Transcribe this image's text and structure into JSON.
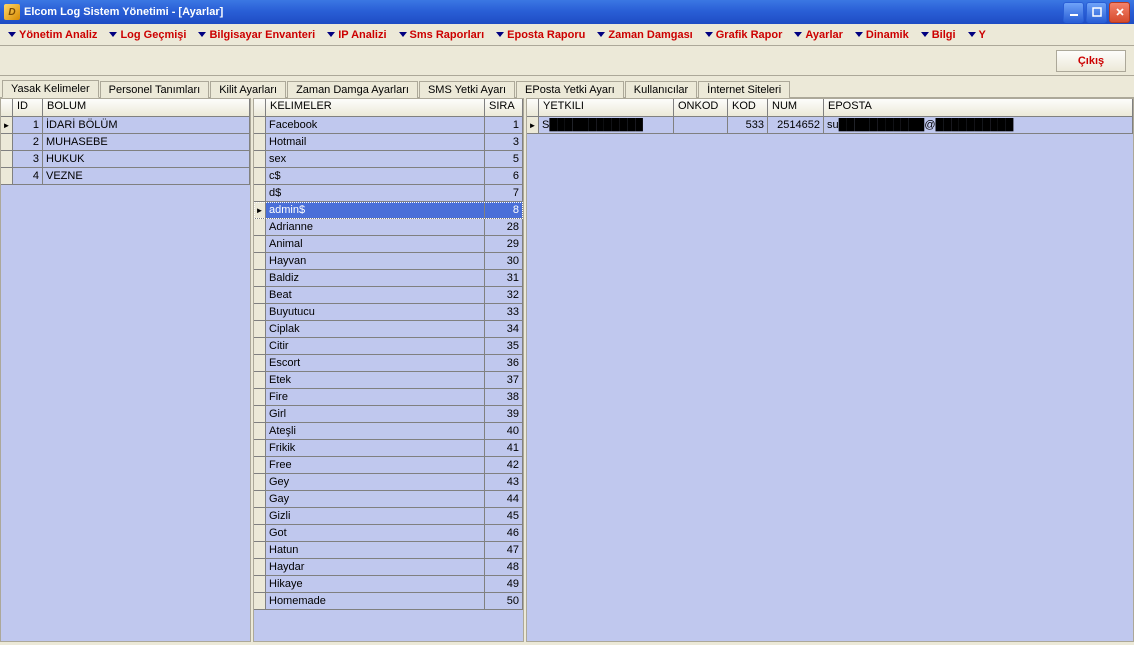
{
  "window": {
    "title": "Elcom Log Sistem Yönetimi - [Ayarlar]"
  },
  "menu": [
    "Yönetim Analiz",
    "Log Geçmişi",
    "Bilgisayar Envanteri",
    "IP Analizi",
    "Sms Raporları",
    "Eposta Raporu",
    "Zaman Damgası",
    "Grafik Rapor",
    "Ayarlar",
    "Dinamik",
    "Bilgi",
    "Y"
  ],
  "toolbar": {
    "logout": "Çıkış"
  },
  "tabs": [
    "Yasak Kelimeler",
    "Personel Tanımları",
    "Kilit Ayarları",
    "Zaman Damga Ayarları",
    "SMS Yetki Ayarı",
    "EPosta Yetki Ayarı",
    "Kullanıcılar",
    "İnternet Siteleri"
  ],
  "activeTab": 0,
  "pane1": {
    "headers": [
      "ID",
      "BOLUM"
    ],
    "rows": [
      {
        "id": "1",
        "bolum": "İDARİ BÖLÜM"
      },
      {
        "id": "2",
        "bolum": "MUHASEBE"
      },
      {
        "id": "3",
        "bolum": "HUKUK"
      },
      {
        "id": "4",
        "bolum": "VEZNE"
      }
    ],
    "current": 0
  },
  "pane2": {
    "headers": [
      "KELIMELER",
      "SIRA"
    ],
    "rows": [
      {
        "k": "Facebook",
        "s": "1"
      },
      {
        "k": "Hotmail",
        "s": "3"
      },
      {
        "k": "sex",
        "s": "5"
      },
      {
        "k": "c$",
        "s": "6"
      },
      {
        "k": "d$",
        "s": "7"
      },
      {
        "k": "admin$",
        "s": "8"
      },
      {
        "k": "Adrianne",
        "s": "28"
      },
      {
        "k": "Animal",
        "s": "29"
      },
      {
        "k": "Hayvan",
        "s": "30"
      },
      {
        "k": "Baldiz",
        "s": "31"
      },
      {
        "k": "Beat",
        "s": "32"
      },
      {
        "k": "Buyutucu",
        "s": "33"
      },
      {
        "k": "Ciplak",
        "s": "34"
      },
      {
        "k": "Citir",
        "s": "35"
      },
      {
        "k": "Escort",
        "s": "36"
      },
      {
        "k": "Etek",
        "s": "37"
      },
      {
        "k": "Fire",
        "s": "38"
      },
      {
        "k": "Girl",
        "s": "39"
      },
      {
        "k": "Ateşli",
        "s": "40"
      },
      {
        "k": "Frikik",
        "s": "41"
      },
      {
        "k": "Free",
        "s": "42"
      },
      {
        "k": "Gey",
        "s": "43"
      },
      {
        "k": "Gay",
        "s": "44"
      },
      {
        "k": "Gizli",
        "s": "45"
      },
      {
        "k": "Got",
        "s": "46"
      },
      {
        "k": "Hatun",
        "s": "47"
      },
      {
        "k": "Haydar",
        "s": "48"
      },
      {
        "k": "Hikaye",
        "s": "49"
      },
      {
        "k": "Homemade",
        "s": "50"
      }
    ],
    "selected": 5,
    "current": 5
  },
  "pane3": {
    "headers": [
      "YETKILI",
      "ONKOD",
      "KOD",
      "NUM",
      "EPOSTA"
    ],
    "rows": [
      {
        "yet": "S████████████",
        "onk": "",
        "kod": "533",
        "num": "2514652",
        "epo": "su███████████@██████████"
      }
    ],
    "current": 0
  }
}
